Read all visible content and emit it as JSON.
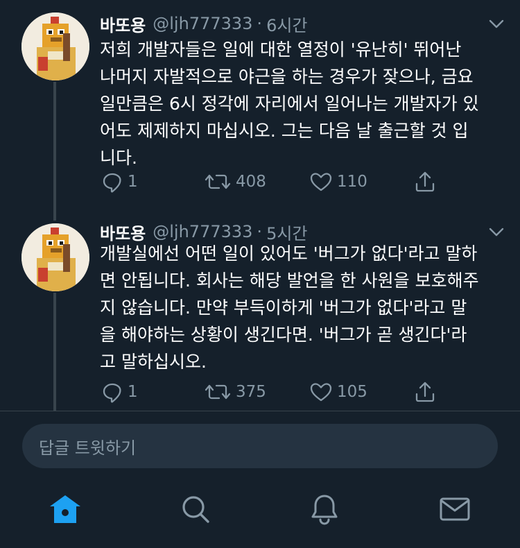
{
  "colors": {
    "background": "#15202b",
    "secondary_text": "#8899a6",
    "accent": "#1da1f2",
    "divider": "#38444d",
    "reply_bar": "#253341"
  },
  "tweets": [
    {
      "name": "바또용",
      "handle": "@ljh777333",
      "separator": "·",
      "time": "6시간",
      "text": "저희 개발자들은 일에 대한 열정이 '유난히' 뛰어난\n나머지 자발적으로 야근을 하는 경우가 잦으나, 금요\n일만큼은 6시 정각에 자리에서 일어나는 개발자가 있\n어도  제제하지 마십시오. 그는 다음 날 출근할 것 입\n니다.",
      "replies": "1",
      "retweets": "408",
      "likes": "110"
    },
    {
      "name": "바또용",
      "handle": "@ljh777333",
      "separator": "·",
      "time": "5시간",
      "text": "개발실에선 어떤 일이 있어도 '버그가 없다'라고 말하\n면 안됩니다. 회사는 해당 발언을 한 사원을 보호해주\n지 않습니다. 만약 부득이하게 '버그가 없다'라고 말\n을 해야하는 상황이 생긴다면. '버그가 곧 생긴다'라\n고 말하십시오.",
      "replies": "1",
      "retweets": "375",
      "likes": "105"
    }
  ],
  "reply_bar": {
    "placeholder": "답글 트윗하기"
  },
  "tabbar": {
    "tabs": [
      {
        "icon": "home-icon",
        "active": true
      },
      {
        "icon": "search-icon",
        "active": false
      },
      {
        "icon": "notifications-icon",
        "active": false
      },
      {
        "icon": "messages-icon",
        "active": false
      }
    ]
  }
}
